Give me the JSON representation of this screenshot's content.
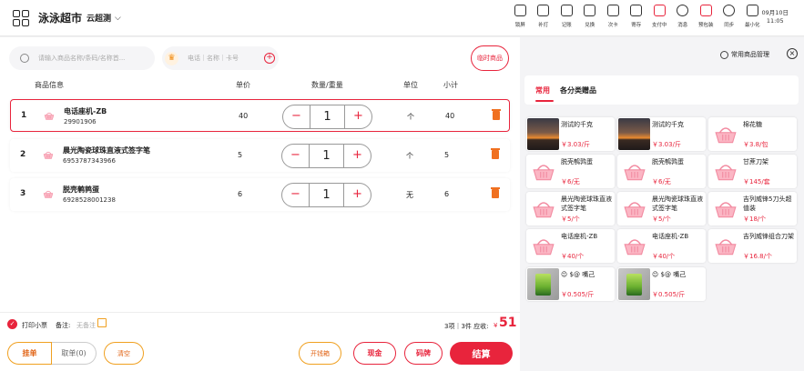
{
  "header": {
    "store_name": "泳泳超市",
    "store_sub": "云超测",
    "chevron": "⌵",
    "date": "09月10日",
    "time": "11:05",
    "tools": [
      {
        "label": "锁屏",
        "icon": "lock-icon"
      },
      {
        "label": "补打",
        "icon": "printer-icon"
      },
      {
        "label": "记账",
        "icon": "ledger-icon"
      },
      {
        "label": "兑换",
        "icon": "exchange-icon"
      },
      {
        "label": "次卡",
        "icon": "card-icon"
      },
      {
        "label": "寄存",
        "icon": "storage-icon"
      },
      {
        "label": "支付中",
        "icon": "paying-icon"
      },
      {
        "label": "消息",
        "icon": "message-icon"
      },
      {
        "label": "预包装",
        "icon": "package-icon"
      },
      {
        "label": "同步",
        "icon": "sync-icon"
      },
      {
        "label": "最小化",
        "icon": "minimize-icon"
      }
    ]
  },
  "search": {
    "placeholder": "请输入商品名称/条码/名称首..."
  },
  "member": {
    "placeholder": "电话｜名称｜卡号",
    "plus": "+"
  },
  "temp_button": "临时商品",
  "table": {
    "headers": {
      "info": "商品信息",
      "price": "单价",
      "qty": "数量/重量",
      "unit": "单位",
      "subtotal": "小计"
    },
    "rows": [
      {
        "index": "1",
        "name": "电话座机-ZB",
        "code": "29901906",
        "price": "40",
        "qty": "1",
        "unit": "个",
        "subtotal": "40",
        "selected": true
      },
      {
        "index": "2",
        "name": "晨光陶瓷球珠直液式签字笔",
        "code": "6953787343966",
        "price": "5",
        "qty": "1",
        "unit": "个",
        "subtotal": "5",
        "selected": false
      },
      {
        "index": "3",
        "name": "脱壳鹌鹑蛋",
        "code": "6928528001238",
        "price": "6",
        "qty": "1",
        "unit": "无",
        "subtotal": "6",
        "selected": false
      }
    ],
    "minus": "−",
    "plus": "+"
  },
  "bottom": {
    "print_label": "打印小票",
    "check": "✓",
    "remark_label": "备注:",
    "remark_value": "无备注",
    "summary": "3项｜3件 应收:",
    "yen": "¥",
    "total": "51",
    "buttons": {
      "hang": "挂单",
      "take": "取单(0)",
      "clear": "清空",
      "open_drawer": "开钱箱",
      "cash": "现金",
      "code": "码牌",
      "pay": "结算"
    }
  },
  "right": {
    "manage_label": "常用商品管理",
    "close": "×",
    "tabs": [
      "常用",
      "各分类赠品"
    ],
    "products": [
      {
        "name": "测试的千克",
        "price": "￥3.03/斤",
        "thumb": "sunset"
      },
      {
        "name": "测试的千克",
        "price": "￥3.03/斤",
        "thumb": "sunset"
      },
      {
        "name": "棉花糖",
        "price": "￥3.8/包",
        "thumb": "basket"
      },
      {
        "name": "脱壳鹌鹑蛋",
        "price": "￥6/无",
        "thumb": "basket"
      },
      {
        "name": "脱壳鹌鹑蛋",
        "price": "￥6/无",
        "thumb": "basket"
      },
      {
        "name": "甘蔗刀架",
        "price": "￥145/套",
        "thumb": "basket"
      },
      {
        "name": "晨光陶瓷球珠直液式签字笔",
        "price": "￥5/个",
        "thumb": "basket"
      },
      {
        "name": "晨光陶瓷球珠直液式签字笔",
        "price": "￥5/个",
        "thumb": "basket"
      },
      {
        "name": "吉列威锋5刀头超值装",
        "price": "￥18/个",
        "thumb": "basket"
      },
      {
        "name": "电话座机-ZB",
        "price": "￥40/个",
        "thumb": "basket"
      },
      {
        "name": "电话座机-ZB",
        "price": "￥40/个",
        "thumb": "basket"
      },
      {
        "name": "吉列威锋组合刀架",
        "price": "￥16.8/个",
        "thumb": "basket"
      },
      {
        "name": "😉 $@ 嘴己",
        "price": "￥0.505/斤",
        "thumb": "green"
      },
      {
        "name": "😉 $@ 嘴己",
        "price": "￥0.505/斤",
        "thumb": "green"
      }
    ]
  },
  "colors": {
    "accent": "#e8243c",
    "orange": "#f0a020",
    "trash": "#f07020"
  }
}
